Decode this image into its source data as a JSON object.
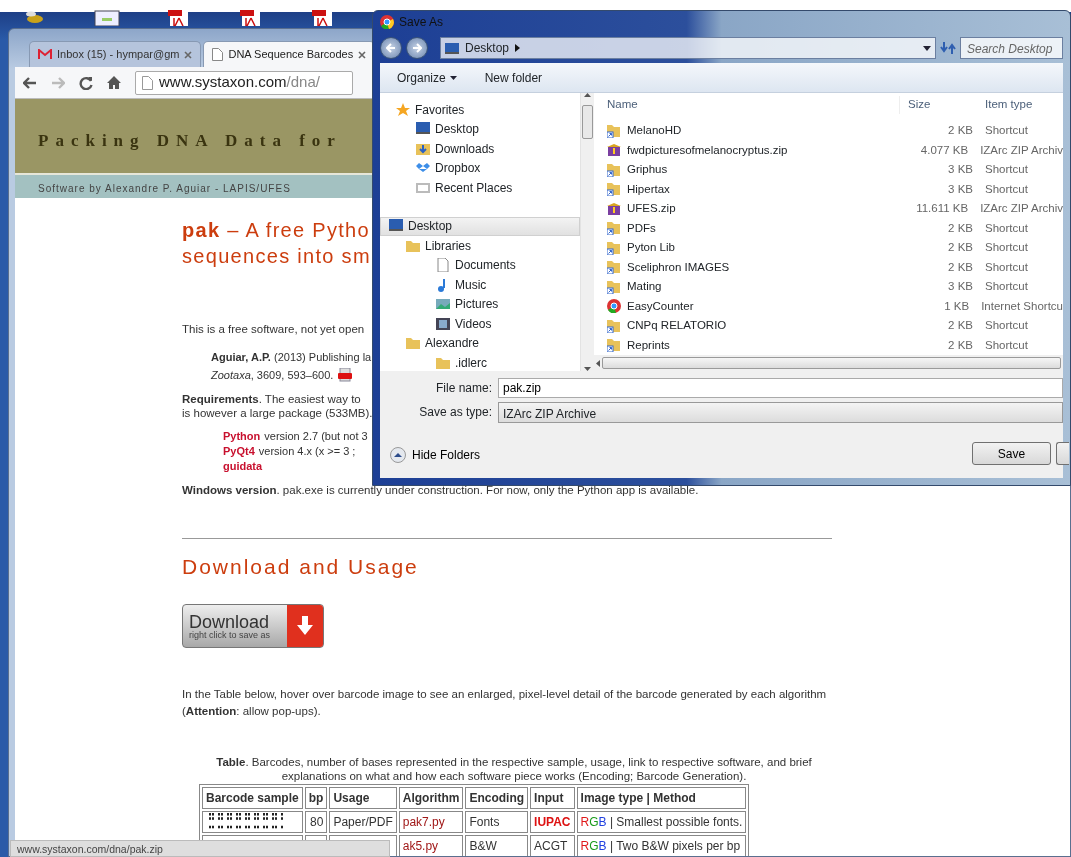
{
  "browser": {
    "tabs": [
      {
        "label": "Inbox (15) - hympar@gm",
        "selected": false,
        "kind": "mail"
      },
      {
        "label": "DNA Sequence Barcodes",
        "selected": true,
        "kind": "page"
      }
    ],
    "url_host": "www.systaxon.com",
    "url_path": "/dna/"
  },
  "page": {
    "banner_title": "Packing DNA Data for",
    "byline": "Software by Alexandre P. Aguiar - LAPIS/UFES",
    "heading_lines": [
      "**pak** – A free Pytho",
      "sequences into sm"
    ],
    "intro": "This is a free software, not yet open",
    "citation_lines": [
      "**Aguiar, A.P.** (2013) Publishing la",
      "*Zootaxa*, 3609, 593–600."
    ],
    "requirements_lines": [
      "**Requirements**. The easiest way to",
      "is however a large package (533MB)."
    ],
    "dependencies": [
      {
        "name": "Python",
        "text": "version 2.7 (but not 3"
      },
      {
        "name": "PyQt4",
        "text": "version 4.x (x >= 3 ;"
      },
      {
        "name": "guidata"
      }
    ],
    "windows_note": "**Windows version**. pak.exe is currently under construction. For now, only the Python app is available.",
    "section_heading": "Download and Usage",
    "download_button": {
      "label": "Download",
      "sublabel": "right click to save as"
    },
    "table_intro": "In the Table below, hover over barcode image to see an enlarged, pixel-level detail of the barcode generated by each algorithm (**Attention**: allow pop-ups).",
    "table_caption": "**Table**. Barcodes, number of bases represented in the respective sample, usage, link to respective software, and brief explanations on what and how each software piece works (Encoding; Barcode Generation).",
    "table": {
      "columns": [
        "Barcode sample",
        "bp",
        "Usage",
        "Algorithm",
        "Encoding",
        "Input",
        "Image type | Method"
      ],
      "rows": [
        {
          "bp": "80",
          "usage": "Paper/PDF",
          "algorithm": "pak7.py",
          "encoding": "Fonts",
          "input": "IUPAC",
          "input_highlight": true,
          "image_type": "RGB",
          "method": " | Smallest possible fonts."
        },
        {
          "algorithm": "ak5.py",
          "encoding": "B&W",
          "input": "ACGT",
          "input_highlight": false,
          "image_type": "RGB",
          "method": " | Two B&W pixels per bp"
        }
      ]
    }
  },
  "status_bar": "www.systaxon.com/dna/pak.zip",
  "dialog": {
    "title": "Save As",
    "location": "Desktop",
    "search_placeholder": "Search Desktop",
    "toolbar": [
      {
        "label": "Organize",
        "dropdown": true
      },
      {
        "label": "New folder",
        "dropdown": false
      }
    ],
    "nav_tree": [
      {
        "label": "Favorites",
        "kind": "star",
        "selected": false,
        "children": [
          {
            "label": "Desktop",
            "kind": "desktop",
            "selected": false
          },
          {
            "label": "Downloads",
            "kind": "downloads",
            "selected": false
          },
          {
            "label": "Dropbox",
            "kind": "dropbox",
            "selected": false
          },
          {
            "label": "Recent Places",
            "kind": "recent",
            "selected": false
          }
        ]
      },
      {
        "label": "Desktop",
        "kind": "desktop",
        "selected": true,
        "children": [
          {
            "label": "Libraries",
            "kind": "folder",
            "selected": false,
            "children": [
              {
                "label": "Documents",
                "kind": "document",
                "selected": false
              },
              {
                "label": "Music",
                "kind": "music",
                "selected": false
              },
              {
                "label": "Pictures",
                "kind": "pictures",
                "selected": false
              },
              {
                "label": "Videos",
                "kind": "videos",
                "selected": false
              }
            ]
          },
          {
            "label": "Alexandre",
            "kind": "folder",
            "selected": false,
            "children": [
              {
                "label": ".idlerc",
                "kind": "folder",
                "selected": false
              }
            ]
          }
        ]
      }
    ],
    "columns": [
      "Name",
      "Size",
      "Item type"
    ],
    "files": [
      {
        "name": "MelanoHD",
        "size": "2 KB",
        "type": "Shortcut",
        "kind": "shortcut"
      },
      {
        "name": "fwdpicturesofmelanocryptus.zip",
        "size": "4.077 KB",
        "type": "IZArc ZIP Archiv",
        "kind": "zip"
      },
      {
        "name": "Griphus",
        "size": "3 KB",
        "type": "Shortcut",
        "kind": "shortcut"
      },
      {
        "name": "Hipertax",
        "size": "3 KB",
        "type": "Shortcut",
        "kind": "shortcut"
      },
      {
        "name": "UFES.zip",
        "size": "11.611 KB",
        "type": "IZArc ZIP Archiv",
        "kind": "zip"
      },
      {
        "name": "PDFs",
        "size": "2 KB",
        "type": "Shortcut",
        "kind": "shortcut"
      },
      {
        "name": "Pyton Lib",
        "size": "2 KB",
        "type": "Shortcut",
        "kind": "shortcut"
      },
      {
        "name": "Sceliphron IMAGES",
        "size": "2 KB",
        "type": "Shortcut",
        "kind": "shortcut"
      },
      {
        "name": "Mating",
        "size": "3 KB",
        "type": "Shortcut",
        "kind": "shortcut"
      },
      {
        "name": "EasyCounter",
        "size": "1 KB",
        "type": "Internet Shortcu",
        "kind": "web"
      },
      {
        "name": "CNPq RELATORIO",
        "size": "2 KB",
        "type": "Shortcut",
        "kind": "shortcut"
      },
      {
        "name": "Reprints",
        "size": "2 KB",
        "type": "Shortcut",
        "kind": "shortcut"
      }
    ],
    "file_name_label": "File name:",
    "file_name": "pak.zip",
    "save_type_label": "Save as type:",
    "save_type": "IZArc ZIP Archive",
    "hide_folders": "Hide Folders",
    "save_button": "Save"
  }
}
